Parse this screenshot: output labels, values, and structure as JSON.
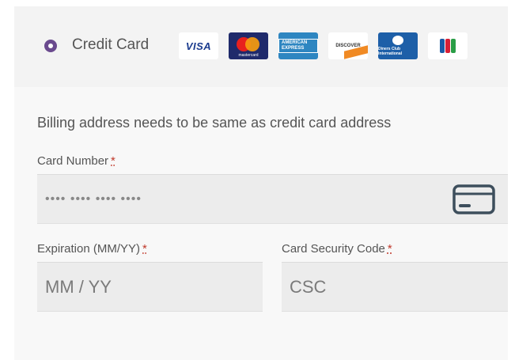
{
  "payment_method": {
    "label": "Credit Card",
    "selected": true,
    "logos": [
      {
        "name": "visa",
        "text": "VISA"
      },
      {
        "name": "mastercard",
        "text": "mastercard"
      },
      {
        "name": "amex",
        "text": "AMERICAN EXPRESS"
      },
      {
        "name": "discover",
        "text": "DISCOVER"
      },
      {
        "name": "diners",
        "text": "Diners Club International"
      },
      {
        "name": "jcb",
        "text": ""
      }
    ]
  },
  "notice": "Billing address needs to be same as credit card address",
  "card_number": {
    "label": "Card Number",
    "required_mark": "*",
    "placeholder": "•••• •••• •••• ••••"
  },
  "expiration": {
    "label": "Expiration (MM/YY)",
    "required_mark": "*",
    "placeholder": "MM / YY"
  },
  "security_code": {
    "label": "Card Security Code",
    "required_mark": "*",
    "placeholder": "CSC"
  },
  "colors": {
    "radio": "#6a4a8e",
    "required": "#c0392b",
    "card_icon": "#3d4e5c"
  }
}
